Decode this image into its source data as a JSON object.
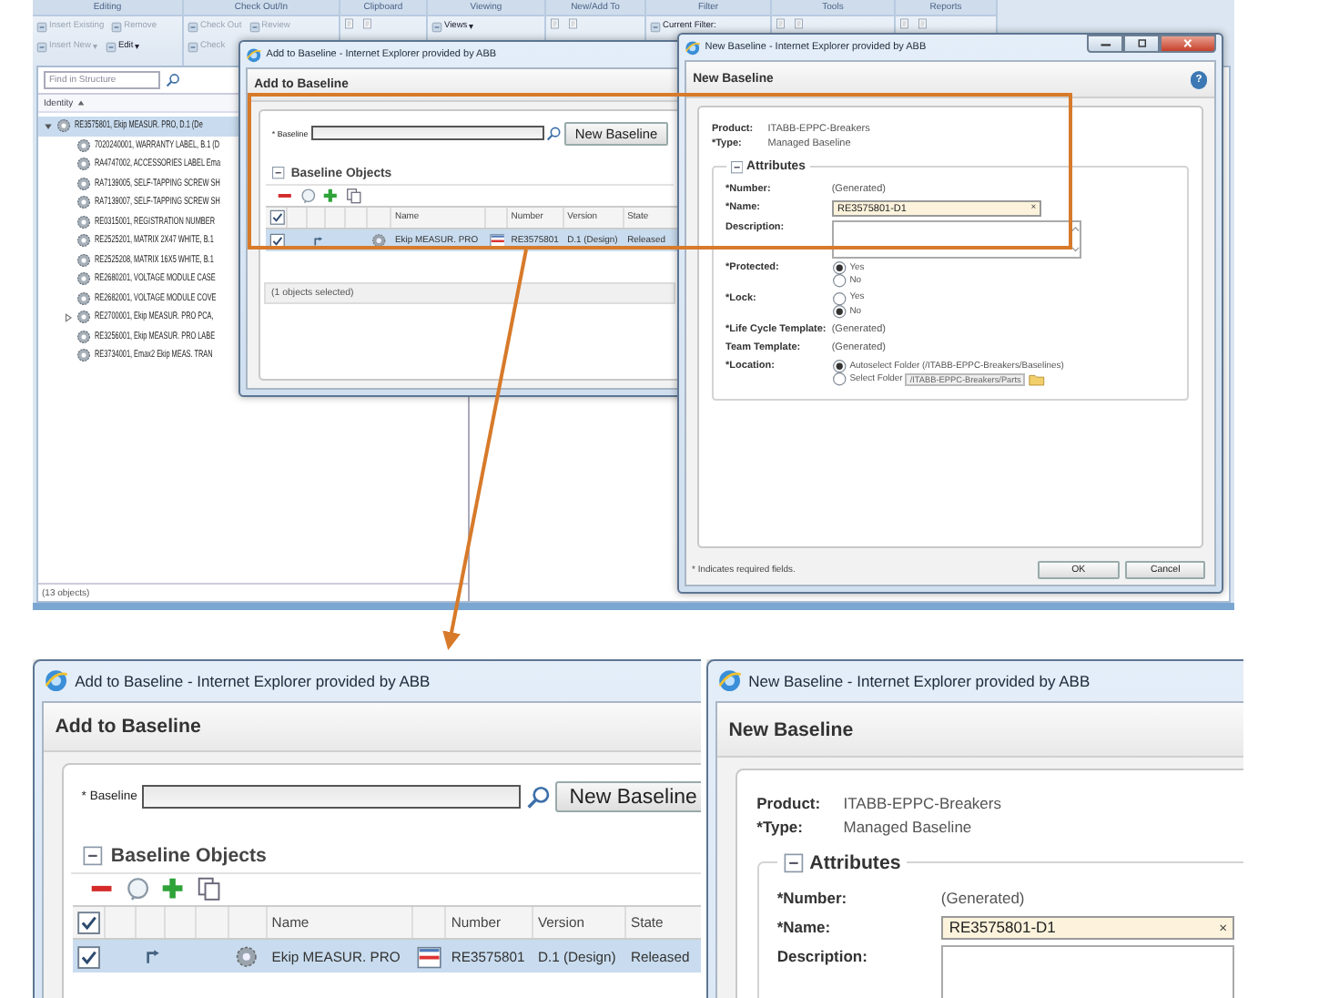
{
  "ribbon": [
    {
      "label": "Editing",
      "buttons": [
        {
          "label": "Insert Existing",
          "disabled": true
        },
        {
          "label": "Remove",
          "disabled": true
        },
        {
          "label": "Insert New",
          "disabled": true,
          "menu": "▾"
        },
        {
          "label": "Edit",
          "disabled": false,
          "menu": "▾"
        }
      ]
    },
    {
      "label": "Check Out/In",
      "buttons": [
        {
          "label": "Check Out",
          "disabled": true
        },
        {
          "label": "Review",
          "disabled": true
        },
        {
          "label": "Check",
          "disabled": true
        }
      ]
    },
    {
      "label": "Clipboard"
    },
    {
      "label": "Viewing",
      "buttons": [
        {
          "label": "Views",
          "disabled": false,
          "menu": "▾"
        }
      ]
    },
    {
      "label": "New/Add To"
    },
    {
      "label": "Filter",
      "buttons": [
        {
          "label": "Current Filter:",
          "disabled": false
        }
      ]
    },
    {
      "label": "Tools"
    },
    {
      "label": "Reports"
    }
  ],
  "structure": {
    "search_placeholder": "Find in Structure",
    "column": "Identity",
    "items": [
      {
        "label": "RE3575801, Ekip MEASUR. PRO, D.1 (De",
        "selected": true,
        "expanded": true,
        "children": [
          {
            "label": "7020240001, WARRANTY LABEL, B.1 (D",
            "selected": false
          },
          {
            "label": "RA4747002, ACCESSORIES LABEL Ema",
            "selected": false
          },
          {
            "label": "RA7139005, SELF-TAPPING SCREW SH",
            "selected": false
          },
          {
            "label": "RA7139007, SELF-TAPPING SCREW SH",
            "selected": false
          },
          {
            "label": "RE0315001, REGISTRATION NUMBER",
            "selected": false
          },
          {
            "label": "RE2525201, MATRIX 2X47 WHITE, B.1",
            "selected": false
          },
          {
            "label": "RE2525208, MATRIX 16X5 WHITE, B.1",
            "selected": false
          },
          {
            "label": "RE2680201, VOLTAGE MODULE CASE",
            "selected": false
          },
          {
            "label": "RE2682001, VOLTAGE MODULE COVE",
            "selected": false
          },
          {
            "label": "RE2700001, Ekip MEASUR. PRO PCA,",
            "selected": false,
            "expanded": false
          },
          {
            "label": "RE3256001, Ekip MEASUR. PRO LABE",
            "selected": false
          },
          {
            "label": "RE3734001, Emax2 Ekip MEAS. TRAN",
            "selected": false
          }
        ]
      }
    ],
    "status": "(13 objects)"
  },
  "add_to_baseline": {
    "title": "Add to Baseline - Internet Explorer provided by ABB",
    "heading": "Add to Baseline",
    "baseline_label": "* Baseline",
    "new_button": "New Baseline",
    "section": {
      "label": "Baseline Objects",
      "expanded": true
    },
    "all_checked": true,
    "columns": [
      "Name",
      "Number",
      "Version",
      "State"
    ],
    "rows": [
      {
        "selected": true,
        "checked": true,
        "name": "Ekip MEASUR. PRO",
        "number": "RE3575801",
        "version": "D.1 (Design)",
        "state": "Released"
      }
    ],
    "status": "(1 objects selected)"
  },
  "new_baseline": {
    "title": "New Baseline - Internet Explorer provided by ABB",
    "window_controls": true,
    "heading": "New Baseline",
    "help": "?",
    "product": {
      "label": "Product:",
      "value": "ITABB-EPPC-Breakers"
    },
    "type": {
      "label": "*Type:",
      "value": "Managed Baseline"
    },
    "section": {
      "label": "Attributes",
      "expanded": true
    },
    "fields": [
      {
        "kind": "text",
        "label": "*Number:",
        "value": "(Generated)"
      },
      {
        "kind": "input",
        "label": "*Name:",
        "value": "RE3575801-D1",
        "clear": "×"
      },
      {
        "kind": "textarea",
        "label": "Description:"
      },
      {
        "kind": "radio",
        "label": "*Protected:",
        "options": [
          {
            "label": "Yes",
            "selected": true
          },
          {
            "label": "No",
            "selected": false
          }
        ]
      },
      {
        "kind": "radio",
        "label": "*Lock:",
        "options": [
          {
            "label": "Yes",
            "selected": false
          },
          {
            "label": "No",
            "selected": true
          }
        ]
      },
      {
        "kind": "text",
        "label": "*Life Cycle Template:",
        "value": "(Generated)"
      },
      {
        "kind": "text",
        "label": "Team Template:",
        "value": "(Generated)"
      },
      {
        "kind": "location",
        "label": "*Location:",
        "options": [
          {
            "label": "Autoselect Folder (/ITABB-EPPC-Breakers/Baselines)",
            "selected": true
          },
          {
            "label": "Select Folder",
            "selected": false,
            "value": "/ITABB-EPPC-Breakers/Parts"
          }
        ]
      }
    ],
    "footnote": "* Indicates required fields.",
    "buttons": [
      "OK",
      "Cancel"
    ]
  },
  "zoom_add_to_baseline": {
    "title": "Add to Baseline - Internet Explorer provided by ABB",
    "heading": "Add to Baseline",
    "baseline_label": "* Baseline",
    "new_button": "New Baseline",
    "section": {
      "label": "Baseline Objects",
      "expanded": true
    },
    "all_checked": true,
    "columns": [
      "Name",
      "Number",
      "Version",
      "State"
    ],
    "rows": [
      {
        "selected": true,
        "checked": true,
        "name": "Ekip MEASUR. PRO",
        "number": "RE3575801",
        "version": "D.1 (Design)",
        "state": "Released"
      }
    ]
  },
  "zoom_new_baseline": {
    "title": "New Baseline - Internet Explorer provided by ABB",
    "heading": "New Baseline",
    "product": {
      "label": "Product:",
      "value": "ITABB-EPPC-Breakers"
    },
    "type": {
      "label": "*Type:",
      "value": "Managed Baseline"
    },
    "section": {
      "label": "Attributes",
      "expanded": true
    },
    "fields": [
      {
        "kind": "text",
        "label": "*Number:",
        "value": "(Generated)"
      },
      {
        "kind": "input",
        "label": "*Name:",
        "value": "RE3575801-D1",
        "clear": "×"
      },
      {
        "kind": "textarea",
        "label": "Description:"
      }
    ]
  }
}
